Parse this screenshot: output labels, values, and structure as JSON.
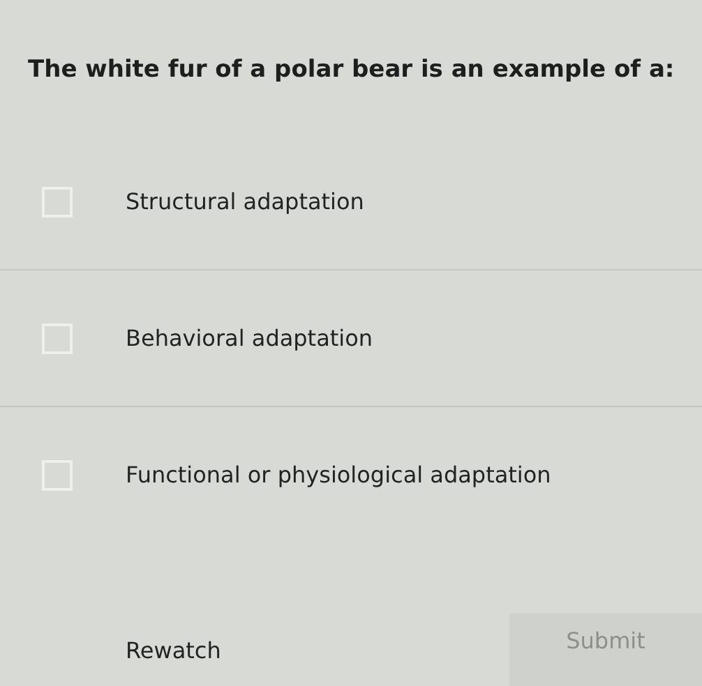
{
  "question": "The white fur of a polar bear is an example of a:",
  "options": [
    {
      "label": "Structural adaptation",
      "checked": false
    },
    {
      "label": "Behavioral adaptation",
      "checked": false
    },
    {
      "label": "Functional or physiological adaptation",
      "checked": false
    }
  ],
  "rewatch": "Rewatch",
  "submit": {
    "label": "Submit",
    "disabled": true
  }
}
